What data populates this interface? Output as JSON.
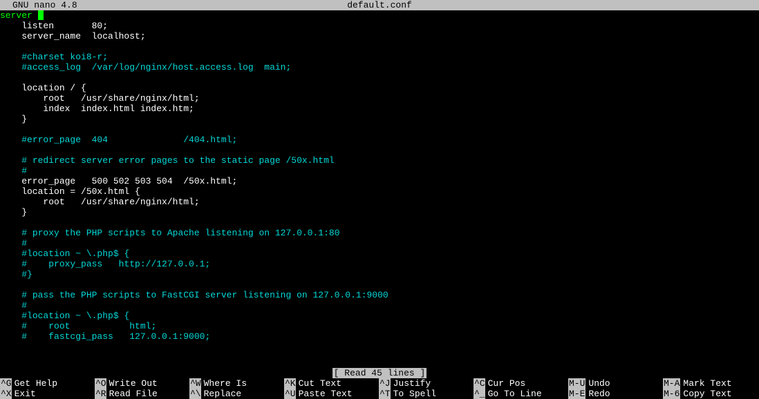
{
  "titlebar": {
    "app": "GNU nano 4.8",
    "filename": "default.conf"
  },
  "lines": [
    {
      "pre": "server ",
      "cursor": true,
      "post": ""
    },
    {
      "text": "    listen       80;",
      "cls": ""
    },
    {
      "text": "    server_name  localhost;",
      "cls": ""
    },
    {
      "text": "",
      "cls": ""
    },
    {
      "text": "    #charset koi8-r;",
      "cls": "c"
    },
    {
      "text": "    #access_log  /var/log/nginx/host.access.log  main;",
      "cls": "c"
    },
    {
      "text": "",
      "cls": ""
    },
    {
      "text": "    location / {",
      "cls": ""
    },
    {
      "text": "        root   /usr/share/nginx/html;",
      "cls": ""
    },
    {
      "text": "        index  index.html index.htm;",
      "cls": ""
    },
    {
      "text": "    }",
      "cls": ""
    },
    {
      "text": "",
      "cls": ""
    },
    {
      "text": "    #error_page  404              /404.html;",
      "cls": "c"
    },
    {
      "text": "",
      "cls": ""
    },
    {
      "text": "    # redirect server error pages to the static page /50x.html",
      "cls": "c"
    },
    {
      "text": "    #",
      "cls": "c"
    },
    {
      "text": "    error_page   500 502 503 504  /50x.html;",
      "cls": ""
    },
    {
      "text": "    location = /50x.html {",
      "cls": ""
    },
    {
      "text": "        root   /usr/share/nginx/html;",
      "cls": ""
    },
    {
      "text": "    }",
      "cls": ""
    },
    {
      "text": "",
      "cls": ""
    },
    {
      "text": "    # proxy the PHP scripts to Apache listening on 127.0.0.1:80",
      "cls": "c"
    },
    {
      "text": "    #",
      "cls": "c"
    },
    {
      "text": "    #location ~ \\.php$ {",
      "cls": "c"
    },
    {
      "text": "    #    proxy_pass   http://127.0.0.1;",
      "cls": "c"
    },
    {
      "text": "    #}",
      "cls": "c"
    },
    {
      "text": "",
      "cls": ""
    },
    {
      "text": "    # pass the PHP scripts to FastCGI server listening on 127.0.0.1:9000",
      "cls": "c"
    },
    {
      "text": "    #",
      "cls": "c"
    },
    {
      "text": "    #location ~ \\.php$ {",
      "cls": "c"
    },
    {
      "text": "    #    root           html;",
      "cls": "c"
    },
    {
      "text": "    #    fastcgi_pass   127.0.0.1:9000;",
      "cls": "c"
    }
  ],
  "firstline_keyword": "server",
  "firstline_brace": "{",
  "status": "[ Read 45 lines ]",
  "shortcuts": {
    "row1": [
      {
        "key": "^G",
        "label": "Get Help"
      },
      {
        "key": "^O",
        "label": "Write Out"
      },
      {
        "key": "^W",
        "label": "Where Is"
      },
      {
        "key": "^K",
        "label": "Cut Text"
      },
      {
        "key": "^J",
        "label": "Justify"
      },
      {
        "key": "^C",
        "label": "Cur Pos"
      },
      {
        "key": "M-U",
        "label": "Undo"
      },
      {
        "key": "M-A",
        "label": "Mark Text"
      }
    ],
    "row2": [
      {
        "key": "^X",
        "label": "Exit"
      },
      {
        "key": "^R",
        "label": "Read File"
      },
      {
        "key": "^\\",
        "label": "Replace"
      },
      {
        "key": "^U",
        "label": "Paste Text"
      },
      {
        "key": "^T",
        "label": "To Spell"
      },
      {
        "key": "^_",
        "label": "Go To Line"
      },
      {
        "key": "M-E",
        "label": "Redo"
      },
      {
        "key": "M-6",
        "label": "Copy Text"
      }
    ]
  }
}
